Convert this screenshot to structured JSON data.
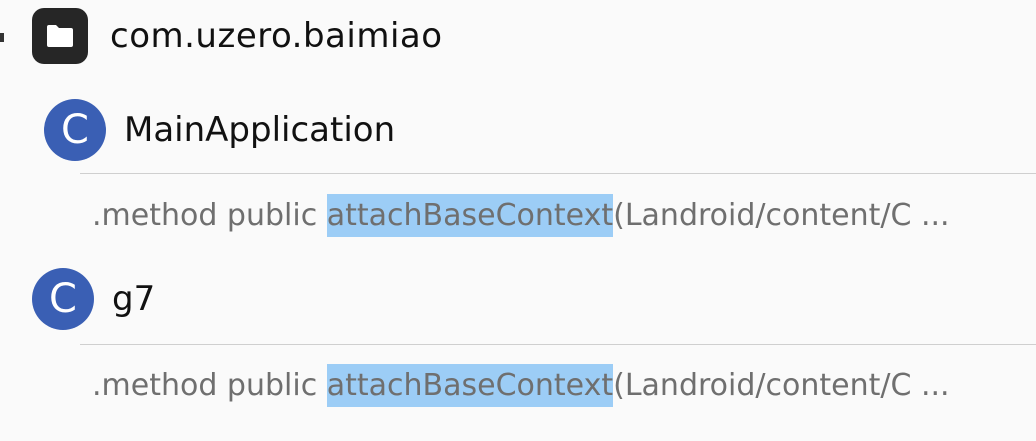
{
  "package": {
    "icon": "folder-icon",
    "name": "com.uzero.baimiao"
  },
  "results": [
    {
      "class_badge": "C",
      "class_name": "MainApplication",
      "method_prefix": ".method public ",
      "match": "attachBaseContext",
      "method_suffix": "(Landroid/content/C ..."
    },
    {
      "class_badge": "C",
      "class_name": "g7",
      "method_prefix": ".method public ",
      "match": "attachBaseContext",
      "method_suffix": "(Landroid/content/C ..."
    }
  ],
  "colors": {
    "class_badge": "#3a5fb4",
    "folder_badge": "#262626",
    "highlight": "#9ccdf6"
  }
}
